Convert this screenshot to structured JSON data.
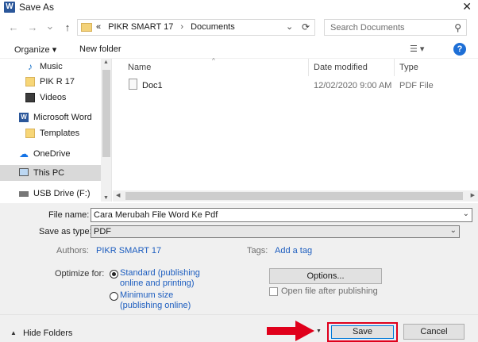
{
  "window": {
    "title": "Save As",
    "close_glyph": "✕"
  },
  "nav": {
    "back_glyph": "←",
    "forward_glyph": "→",
    "recent_glyph": "⌄",
    "up_glyph": "↑",
    "address": {
      "overflow": "«",
      "segments": [
        "PIKR SMART 17",
        "Documents"
      ],
      "separator": "›",
      "dropdown_glyph": "⌄",
      "refresh_glyph": "⟳"
    },
    "search": {
      "placeholder": "Search Documents",
      "icon_glyph": "⚲"
    }
  },
  "toolbar": {
    "organize_label": "Organize ▾",
    "new_folder_label": "New folder",
    "view_glyph": "☰ ▾",
    "help_glyph": "?"
  },
  "sidebar": {
    "items": [
      {
        "label": "Music",
        "icon": "music-icon"
      },
      {
        "label": "PIK R 17",
        "icon": "folder-icon"
      },
      {
        "label": "Videos",
        "icon": "video-icon"
      },
      {
        "label": "Microsoft Word",
        "icon": "word-icon"
      },
      {
        "label": "Templates",
        "icon": "folder-icon"
      },
      {
        "label": "OneDrive",
        "icon": "cloud-icon"
      },
      {
        "label": "This PC",
        "icon": "pc-icon",
        "selected": true
      },
      {
        "label": "USB Drive (F:)",
        "icon": "usb-icon"
      }
    ],
    "music_glyph": "♪",
    "word_glyph": "W",
    "cloud_glyph": "☁"
  },
  "filelist": {
    "columns": [
      "Name",
      "Date modified",
      "Type"
    ],
    "rows": [
      {
        "name": "Doc1",
        "date": "12/02/2020 9:00 AM",
        "type": "PDF File"
      }
    ]
  },
  "form": {
    "file_name_label": "File name:",
    "file_name_value": "Cara Merubah File Word Ke Pdf",
    "save_type_label": "Save as type:",
    "save_type_value": "PDF",
    "authors_label": "Authors:",
    "authors_value": "PIKR SMART 17",
    "tags_label": "Tags:",
    "tags_value": "Add a tag",
    "optimize_label": "Optimize for:",
    "optimize_standard_1": "Standard (publishing",
    "optimize_standard_2": "online and printing)",
    "optimize_minimum_1": "Minimum size",
    "optimize_minimum_2": "(publishing online)",
    "options_label": "Options...",
    "open_after_label": "Open file after publishing"
  },
  "footer": {
    "hide_folders_label": "Hide Folders",
    "save_label": "Save",
    "cancel_label": "Cancel"
  },
  "colors": {
    "accent": "#1c5dbf",
    "highlight_red": "#e0001b",
    "word_blue": "#2b579a"
  }
}
